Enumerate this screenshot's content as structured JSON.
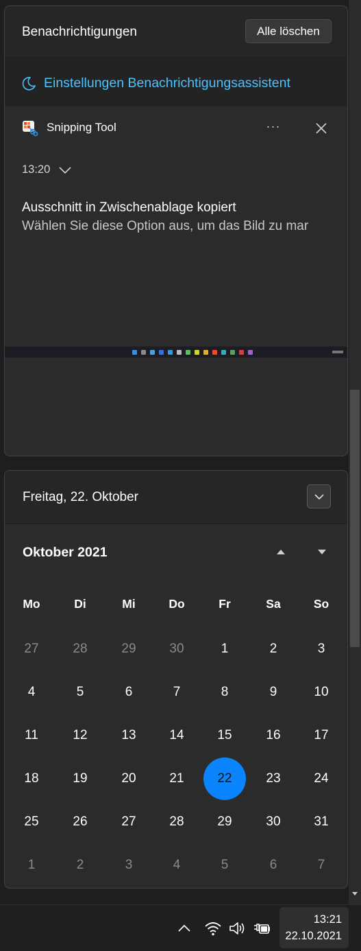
{
  "notifications": {
    "title": "Benachrichtigungen",
    "clear_all_label": "Alle löschen",
    "focus_assist_label": "Einstellungen Benachrichtigungsassistent",
    "card": {
      "app_name": "Snipping Tool",
      "more_label": "···",
      "time": "13:20",
      "message_title": "Ausschnitt in Zwischenablage kopiert",
      "message_body": "Wählen Sie diese Option aus, um das Bild zu mar"
    }
  },
  "calendar": {
    "date_header": "Freitag, 22. Oktober",
    "month_label": "Oktober 2021",
    "weekdays": [
      "Mo",
      "Di",
      "Mi",
      "Do",
      "Fr",
      "Sa",
      "So"
    ],
    "weeks": [
      [
        "27",
        "28",
        "29",
        "30",
        "1",
        "2",
        "3"
      ],
      [
        "4",
        "5",
        "6",
        "7",
        "8",
        "9",
        "10"
      ],
      [
        "11",
        "12",
        "13",
        "14",
        "15",
        "16",
        "17"
      ],
      [
        "18",
        "19",
        "20",
        "21",
        "22",
        "23",
        "24"
      ],
      [
        "25",
        "26",
        "27",
        "28",
        "29",
        "30",
        "31"
      ],
      [
        "1",
        "2",
        "3",
        "4",
        "5",
        "6",
        "7"
      ]
    ],
    "today": "22",
    "colors": {
      "accent": "#0a84ff",
      "link": "#4cc2ff"
    }
  },
  "taskbar": {
    "time": "13:21",
    "date": "22.10.2021",
    "icons": [
      "chevron-up-icon",
      "wifi-icon",
      "speaker-icon",
      "battery-charging-icon"
    ]
  }
}
